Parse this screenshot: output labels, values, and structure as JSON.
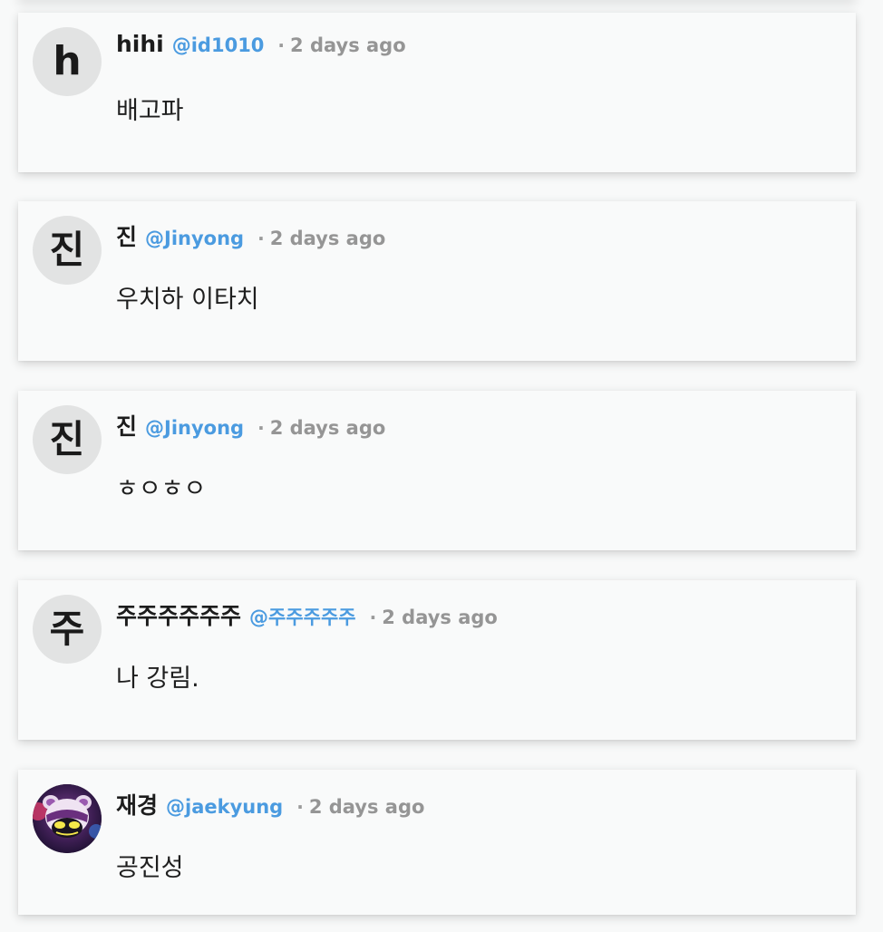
{
  "comments": [
    {
      "avatar_text": "h",
      "author": "hihi",
      "handle": "@id1010",
      "separator": "·",
      "time": "2 days ago",
      "text": "배고파"
    },
    {
      "avatar_text": "진",
      "author": "진",
      "handle": "@Jinyong",
      "separator": "·",
      "time": "2 days ago",
      "text": "우치하 이타치"
    },
    {
      "avatar_text": "진",
      "author": "진",
      "handle": "@Jinyong",
      "separator": "·",
      "time": "2 days ago",
      "text": "ㅎㅇㅎㅇ"
    },
    {
      "avatar_text": "주",
      "author": "주주주주주주",
      "handle": "@주주주주주",
      "separator": "·",
      "time": "2 days ago",
      "text": "나 강림."
    },
    {
      "avatar_icon": "creature-avatar-image",
      "author": "재경",
      "handle": "@jaekyung",
      "separator": "·",
      "time": "2 days ago",
      "text": "공진성"
    }
  ],
  "colors": {
    "background": "#f8f9f9",
    "card": "#f9fafa",
    "handle": "#4b9be0",
    "time": "#959595",
    "avatar_bg": "#e2e3e3"
  }
}
